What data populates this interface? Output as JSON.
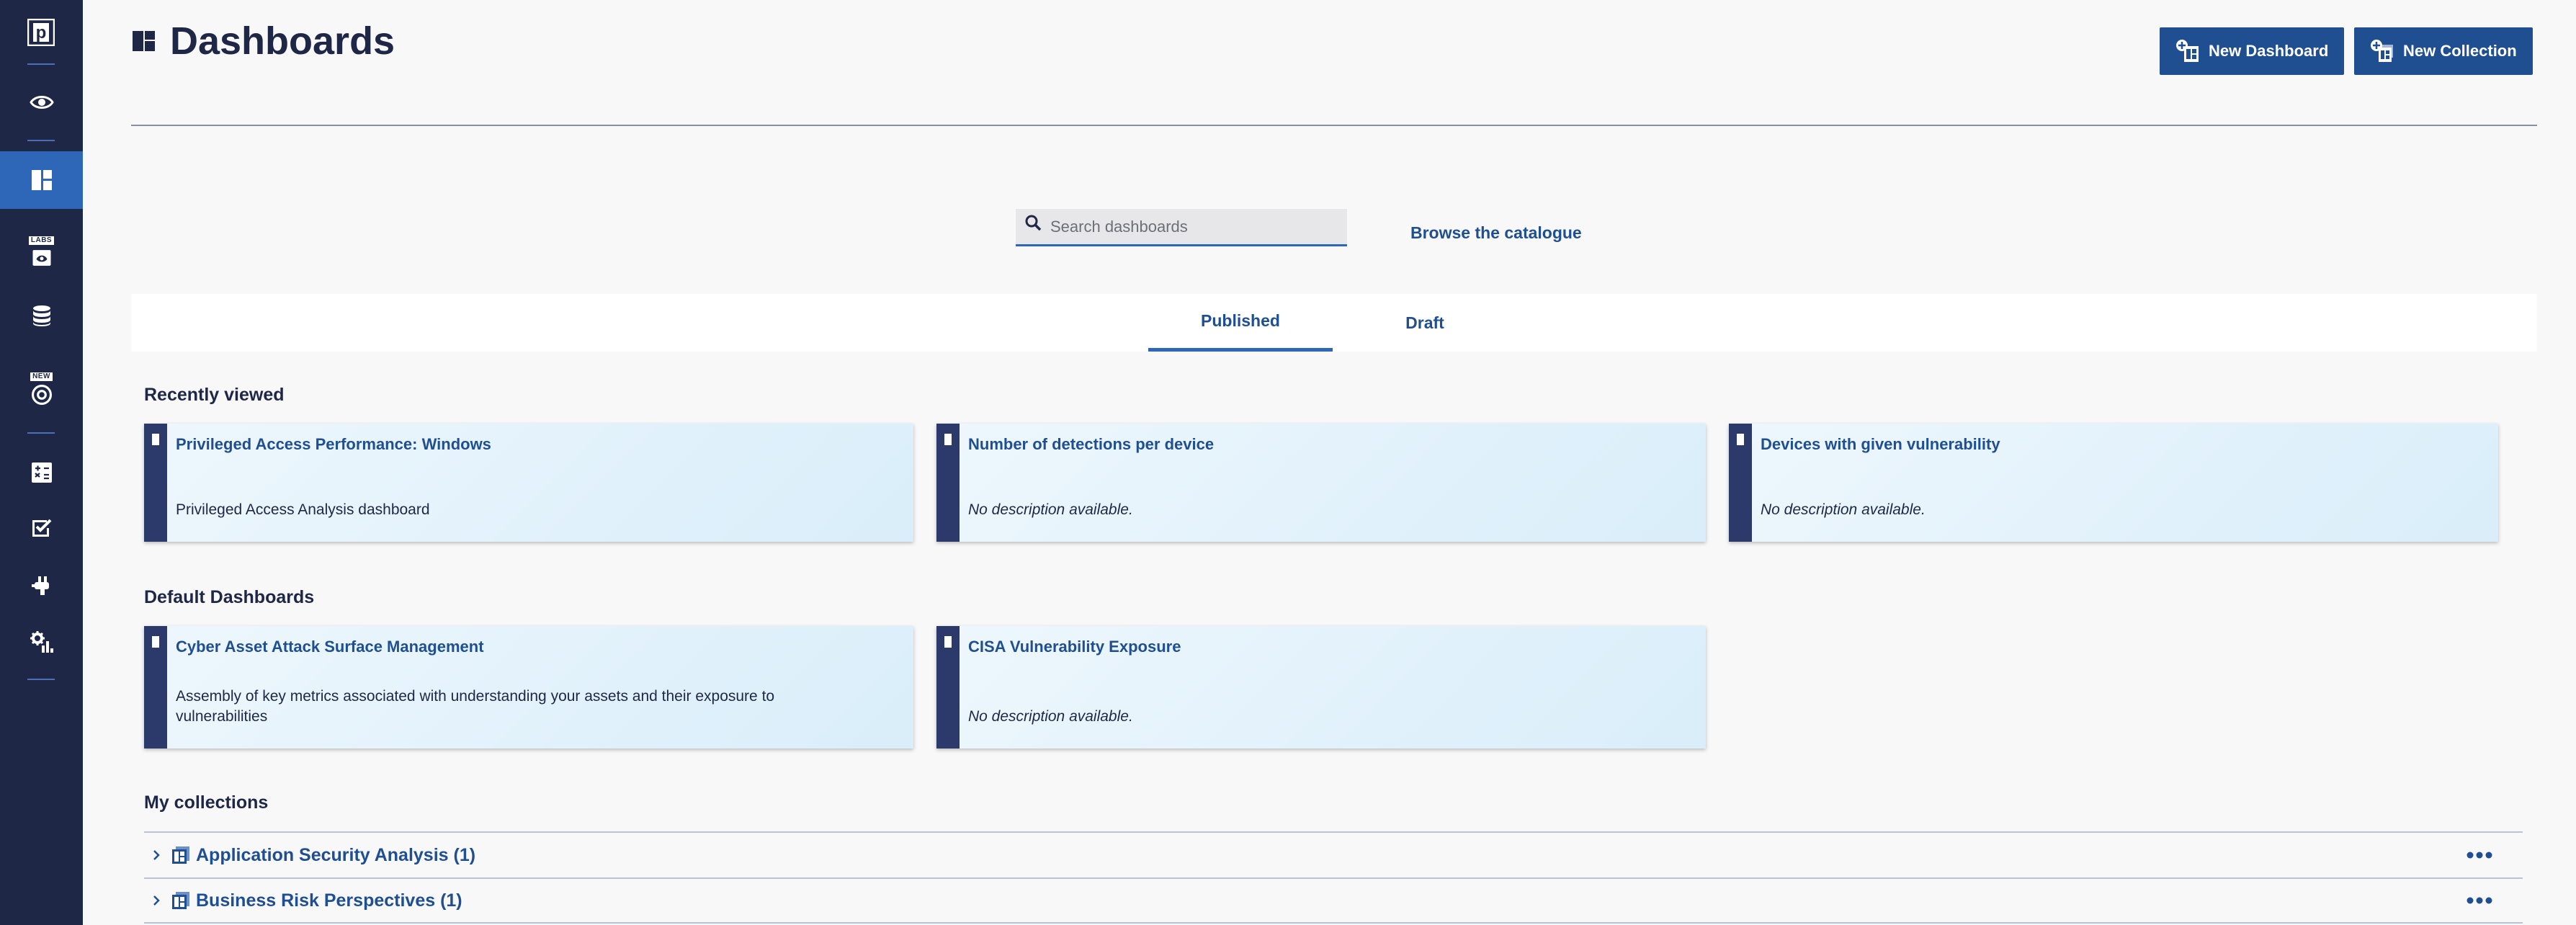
{
  "sidebar": {
    "logo_letter": "p",
    "items": [
      {
        "name": "eye-icon",
        "tag": ""
      },
      {
        "name": "dashboards-icon",
        "tag": ""
      },
      {
        "name": "labs-icon",
        "tag": "LABS"
      },
      {
        "name": "database-icon",
        "tag": ""
      },
      {
        "name": "target-icon",
        "tag": "NEW"
      },
      {
        "name": "calculator-icon",
        "tag": ""
      },
      {
        "name": "checklist-icon",
        "tag": ""
      },
      {
        "name": "plug-icon",
        "tag": ""
      },
      {
        "name": "settings-chart-icon",
        "tag": ""
      }
    ],
    "active_index": 1
  },
  "header": {
    "title": "Dashboards",
    "new_dashboard_label": "New Dashboard",
    "new_collection_label": "New Collection"
  },
  "search": {
    "placeholder": "Search dashboards",
    "value": "",
    "browse_label": "Browse the catalogue"
  },
  "tabs": [
    {
      "label": "Published",
      "active": true
    },
    {
      "label": "Draft",
      "active": false
    }
  ],
  "recently_viewed": {
    "title": "Recently viewed",
    "cards": [
      {
        "title": "Privileged Access Performance: Windows",
        "description": "Privileged Access Analysis dashboard"
      },
      {
        "title": "Number of detections per device",
        "description": "No description available."
      },
      {
        "title": "Devices with given vulnerability",
        "description": "No description available."
      }
    ]
  },
  "default_dashboards": {
    "title": "Default Dashboards",
    "cards": [
      {
        "title": "Cyber Asset Attack Surface Management",
        "description": "Assembly of key metrics associated with understanding your assets and their exposure to vulnerabilities"
      },
      {
        "title": "CISA Vulnerability Exposure",
        "description": "No description available."
      }
    ]
  },
  "collections": {
    "title": "My collections",
    "items": [
      {
        "label": "Application Security Analysis (1)"
      },
      {
        "label": "Business Risk Perspectives (1)"
      }
    ]
  },
  "colors": {
    "sidebar_bg": "#1f2746",
    "accent": "#2f67b8",
    "button_bg": "#1f4f91",
    "card_stripe": "#2c3a6b"
  }
}
